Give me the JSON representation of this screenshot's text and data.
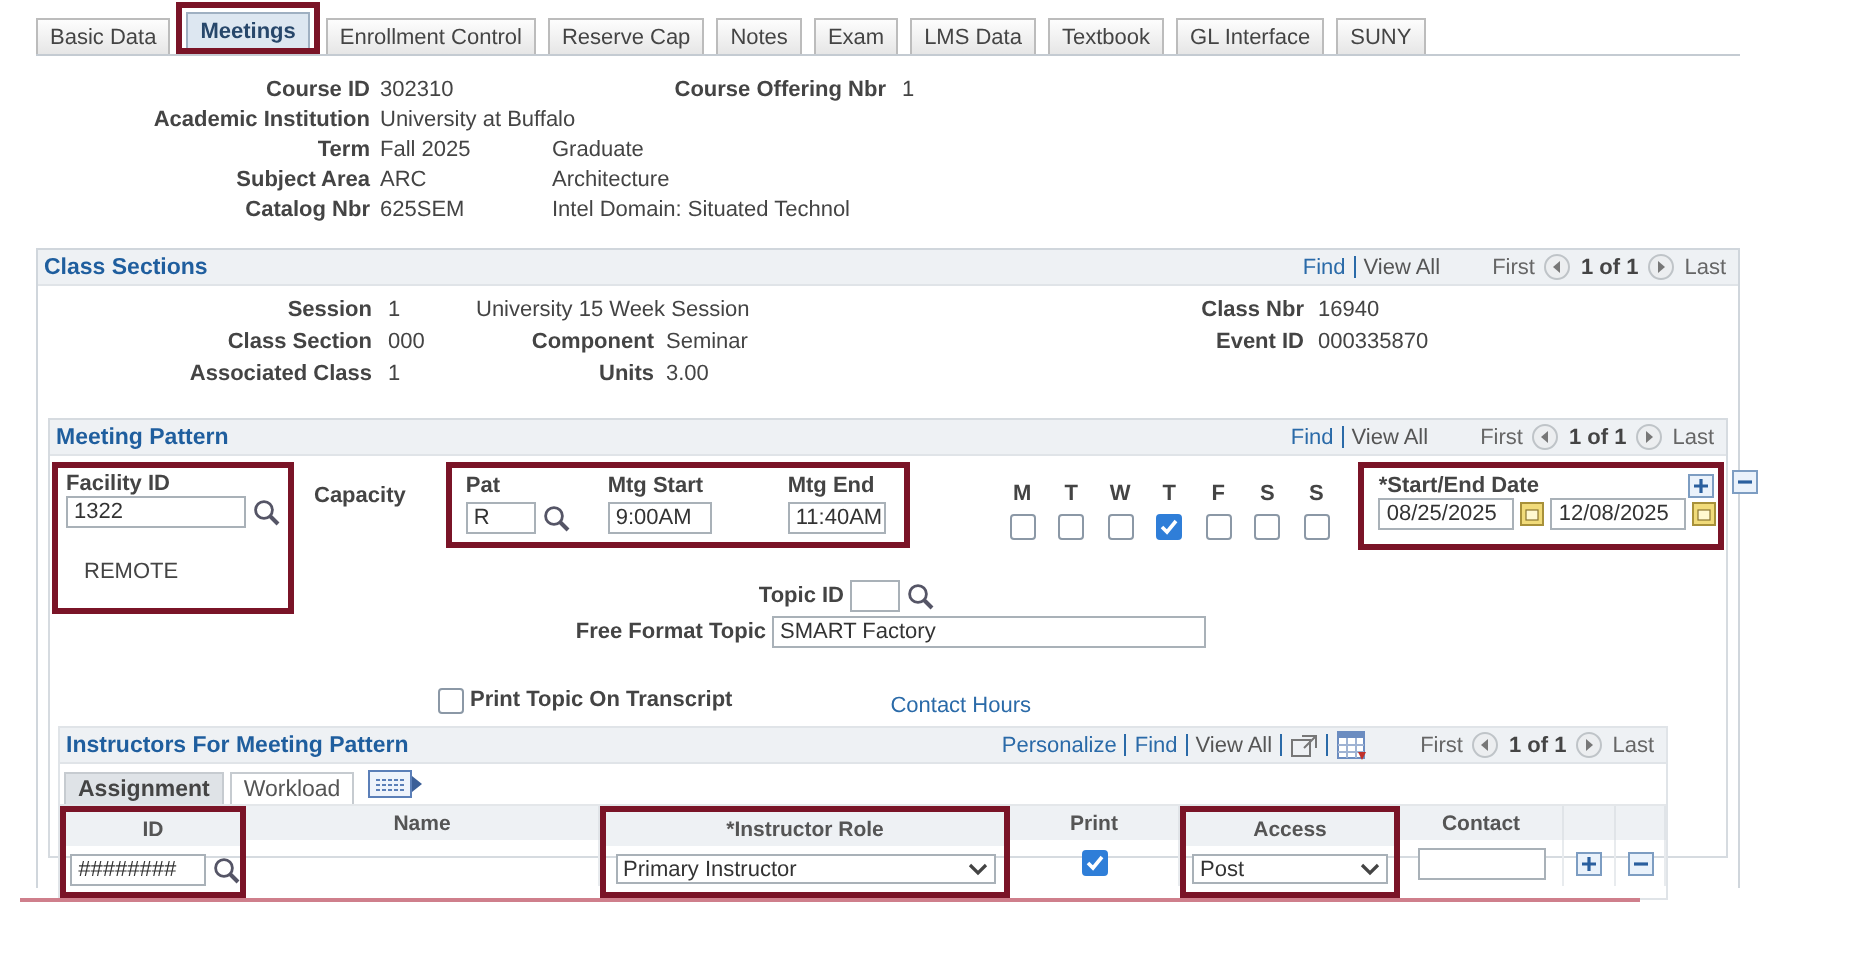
{
  "tabs": [
    {
      "label": "Basic Data",
      "selected": false,
      "highlighted": false
    },
    {
      "label": "Meetings",
      "selected": true,
      "highlighted": true
    },
    {
      "label": "Enrollment Control",
      "selected": false,
      "highlighted": false
    },
    {
      "label": "Reserve Cap",
      "selected": false,
      "highlighted": false
    },
    {
      "label": "Notes",
      "selected": false,
      "highlighted": false
    },
    {
      "label": "Exam",
      "selected": false,
      "highlighted": false
    },
    {
      "label": "LMS Data",
      "selected": false,
      "highlighted": false
    },
    {
      "label": "Textbook",
      "selected": false,
      "highlighted": false
    },
    {
      "label": "GL Interface",
      "selected": false,
      "highlighted": false
    },
    {
      "label": "SUNY",
      "selected": false,
      "highlighted": false
    }
  ],
  "course": {
    "fields": [
      {
        "label": "Course ID",
        "value": "302310"
      },
      {
        "label": "Academic Institution",
        "value": "University at Buffalo"
      },
      {
        "label": "Term",
        "value": "Fall 2025",
        "description": "Graduate"
      },
      {
        "label": "Subject Area",
        "value": "ARC",
        "description": "Architecture"
      },
      {
        "label": "Catalog Nbr",
        "value": "625SEM",
        "description": "Intel Domain: Situated Technol"
      }
    ],
    "offering": {
      "label": "Course Offering Nbr",
      "value": "1"
    }
  },
  "class_sections": {
    "title": "Class Sections",
    "nav": {
      "find": "Find",
      "view_all": "View All",
      "first": "First",
      "count": "1 of 1",
      "last": "Last"
    },
    "session": {
      "label": "Session",
      "value": "1",
      "description": "University 15 Week Session"
    },
    "class_section": {
      "label": "Class Section",
      "value": "000"
    },
    "associated_class": {
      "label": "Associated Class",
      "value": "1"
    },
    "component": {
      "label": "Component",
      "value": "Seminar"
    },
    "units": {
      "label": "Units",
      "value": "3.00"
    },
    "class_nbr": {
      "label": "Class Nbr",
      "value": "16940"
    },
    "event_id": {
      "label": "Event ID",
      "value": "000335870"
    }
  },
  "meeting_pattern": {
    "title": "Meeting Pattern",
    "nav": {
      "find": "Find",
      "view_all": "View All",
      "first": "First",
      "count": "1 of 1",
      "last": "Last"
    },
    "facility": {
      "label": "Facility ID",
      "value": "1322",
      "description": "REMOTE",
      "highlighted": true
    },
    "capacity": {
      "label": "Capacity"
    },
    "pattern": {
      "highlighted": true,
      "pat": {
        "label": "Pat",
        "value": "R"
      },
      "mtg_start": {
        "label": "Mtg Start",
        "value": "9:00AM"
      },
      "mtg_end": {
        "label": "Mtg End",
        "value": "11:40AM"
      }
    },
    "days": [
      {
        "label": "M",
        "checked": false
      },
      {
        "label": "T",
        "checked": false
      },
      {
        "label": "W",
        "checked": false
      },
      {
        "label": "T",
        "checked": true
      },
      {
        "label": "F",
        "checked": false
      },
      {
        "label": "S",
        "checked": false
      },
      {
        "label": "S",
        "checked": false
      }
    ],
    "dates": {
      "label": "*Start/End Date",
      "start": "08/25/2025",
      "end": "12/08/2025",
      "highlighted": true
    },
    "topic_id": {
      "label": "Topic ID"
    },
    "free_format_topic": {
      "label": "Free Format Topic",
      "value": "SMART Factory"
    },
    "print_topic": {
      "label": "Print Topic On Transcript",
      "checked": false
    },
    "contact_hours": "Contact Hours"
  },
  "instructors": {
    "title": "Instructors For Meeting Pattern",
    "nav": {
      "personalize": "Personalize",
      "find": "Find",
      "view_all": "View All",
      "first": "First",
      "count": "1 of 1",
      "last": "Last"
    },
    "tabs": [
      {
        "label": "Assignment",
        "selected": true
      },
      {
        "label": "Workload",
        "selected": false
      }
    ],
    "columns": [
      {
        "kind": "id",
        "label": "ID",
        "highlighted": true
      },
      {
        "kind": "name",
        "label": "Name",
        "highlighted": false
      },
      {
        "kind": "role",
        "label": "*Instructor Role",
        "highlighted": true
      },
      {
        "kind": "print",
        "label": "Print",
        "highlighted": false
      },
      {
        "kind": "access",
        "label": "Access",
        "highlighted": true
      },
      {
        "kind": "contact",
        "label": "Contact",
        "highlighted": false
      }
    ],
    "rows": [
      {
        "id": "########",
        "instructor_role": "Primary Instructor",
        "print": true,
        "access": "Post"
      }
    ]
  }
}
